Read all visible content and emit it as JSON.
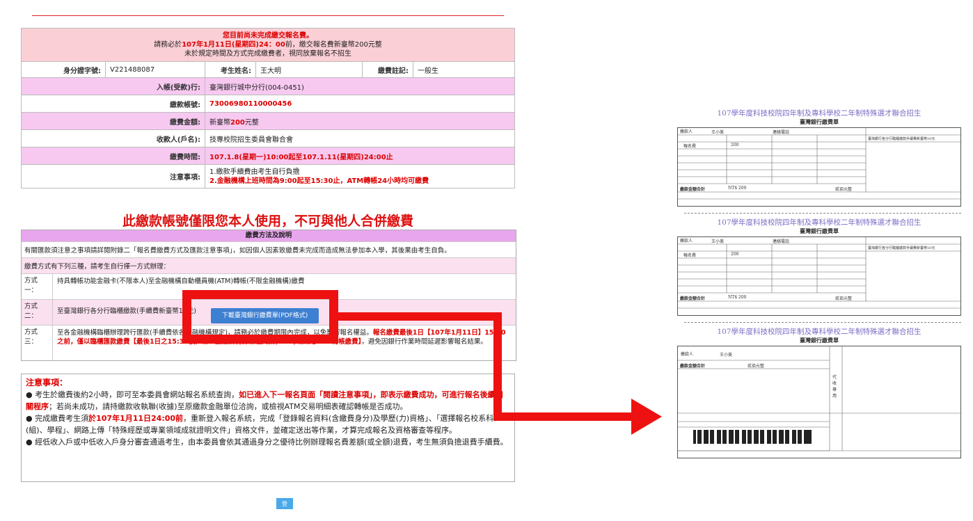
{
  "header": {
    "line1": "您目前尚未完成繳交報名費。",
    "line2_prefix": "請務必於",
    "line2_date": "107年1月11日(星期四)24：00",
    "line2_suffix": "前，繳交報名費新臺幣200元整",
    "line3": "未於規定時間及方式完成繳費者，視同放棄報名不招生"
  },
  "info": {
    "id_label": "身分證字號:",
    "id_value": "V221488087",
    "name_label": "考生姓名:",
    "name_value": "王大明",
    "note_label": "繳費註記:",
    "note_value": "一般生",
    "bank_label": "入帳(受款)行:",
    "bank_value": "臺灣銀行城中分行(004-0451)",
    "account_label": "繳款帳號:",
    "account_value": "73006980110000456",
    "amount_label": "繳費金額:",
    "amount_prefix": "新臺幣",
    "amount_num": "200",
    "amount_suffix": "元整",
    "payee_label": "收款人(戶名):",
    "payee_value": "技專校院招生委員會聯合會",
    "time_label": "繳費時間:",
    "time_value": "107.1.8(星期一)10:00起至107.1.11(星期四)24:00止",
    "notice_label": "注意事項:",
    "notice_1": "1.繳款手續費由考生自行負擔",
    "notice_2": "2.金融機構上班時間為9:00起至15:30止，ATM轉帳24小時均可繳費"
  },
  "warning": "此繳款帳號僅限您本人使用，不可與他人合併繳費",
  "payment": {
    "title": "繳費方法及說明",
    "row1": "有關匯款須注意之事項請詳閱附錄二「報名費繳費方式及匯款注意事項」，如因個人因素致繳費未完成而造成無法參加本入學，其後果由考生自負。",
    "row2": "繳費方式有下列三種，請考生自行擇一方式辦理：",
    "m1_key": "方式一：",
    "m1_text": "持具轉帳功能金融卡(不限本人)至金融機構自動櫃員機(ATM)轉帳(不限金融機構)繳費",
    "m2_key": "方式二：",
    "m2_text": "至臺灣銀行各分行臨櫃繳款(手續費新臺幣10元)",
    "download_button": "下載臺灣銀行繳費單(PDF格式)",
    "m3_key": "方式三：",
    "m3_text": "至各金融機構臨櫃辦理跨行匯款(手續費依各金融機構規定)，請務必於繳費期限內完成，以免影響報名權益。",
    "m3_red": "報名繳費最後1日【107年1月11日】15:30之前，僅以臨櫃匯款繳費【最後1日之15:30後，限以金融機構自動櫃員機(ATM)或網路ATM轉帳繳費】",
    "m3_tail": "，避免因銀行作業時間延遲影響報名結果。"
  },
  "notes": {
    "title": "注意事項：",
    "n1_a": "● 考生於繳費後約2小時，即可至本委員會網站報名系統查詢，",
    "n1_red": "如已進入下一報名頁面「閱讀注意事項」，即表示繳費成功，可進行報名後續相關程序",
    "n1_b": "；若尚未成功，請持繳款收執聯(收據)至原繳款金融單位洽詢，或檢視ATM交易明細表確認轉帳是否成功。",
    "n2_a": "● 完成繳費考生須",
    "n2_red": "於107年1月11日24:00前",
    "n2_b": "，重新登入報名系統，完成「登錄報名資料(含繳費身分)及學歷(力)資格」、「選擇報名校系科(組)、學程」、網路上傳「特殊經歷或專業領域成就證明文件」資格文件，並確定送出等作業，才算完成報名及資格審查等程序。",
    "n3": "● 經低收入戶或中低收入戶身分審查通過考生，由本委員會依其通過身分之優待比例辦理報名費差額(或全額)退費，考生無須負擔退費手續費。"
  },
  "logout_label": "登出",
  "slip": {
    "title": "107學年度科技校院四年制及專科學校二年制特殊選才聯合招生",
    "subtitle": "臺灣銀行繳費單",
    "payer_label": "繳款人",
    "payer_value": "王小美",
    "phone_label": "連絡電話",
    "fee_name": "報名費",
    "fee_amount": "200",
    "total_label": "繳款金額合計",
    "total_value": "NT$ 200",
    "total_chinese": "貳佰元整",
    "collect_label": "代收專用",
    "bank_note": "臺灣銀行各分行臨櫃繳款手續費新臺幣10元"
  },
  "colors": {
    "pink_header": "#fbcfd6",
    "pink_row": "#f7c9f1",
    "accent_red": "#ee1111",
    "button_blue": "#3d7fd1",
    "purple_header": "#e8a6ee"
  }
}
